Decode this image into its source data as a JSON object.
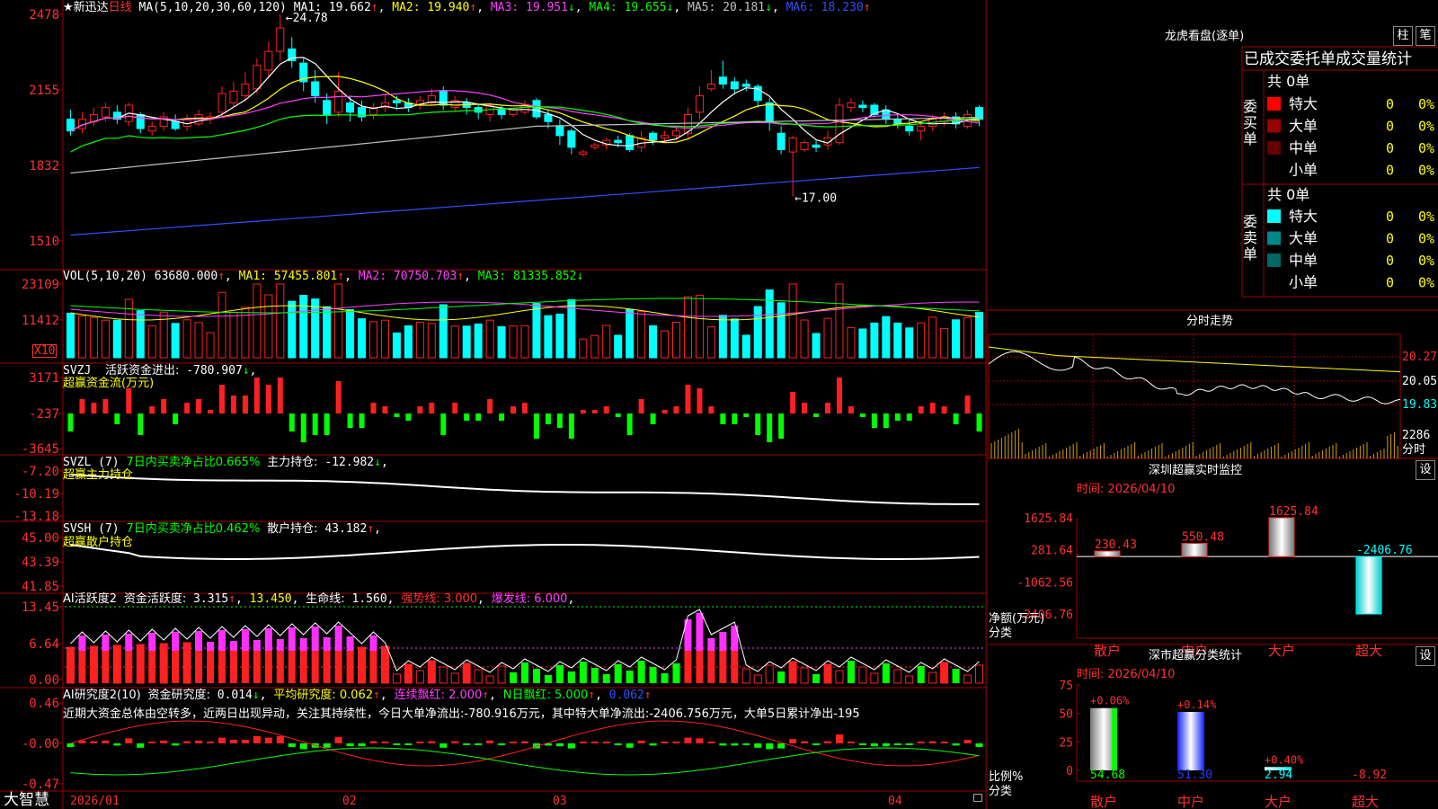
{
  "app": {
    "brand": "大智慧",
    "lock": "🔒"
  },
  "kline": {
    "title": "★新迅达",
    "period": "日线",
    "ma_params": "MA(5,10,20,30,60,120)",
    "ma": [
      {
        "label": "MA1:",
        "value": "19.662",
        "arrow": "↑",
        "color": "#ffffff"
      },
      {
        "label": "MA2:",
        "value": "19.940",
        "arrow": "↑",
        "color": "#ffff00"
      },
      {
        "label": "MA3:",
        "value": "19.951",
        "arrow": "↓",
        "color": "#ff40ff"
      },
      {
        "label": "MA4:",
        "value": "19.655",
        "arrow": "↓",
        "color": "#00ff00"
      },
      {
        "label": "MA5:",
        "value": "20.181",
        "arrow": "↓",
        "color": "#c0c0c0"
      },
      {
        "label": "MA6:",
        "value": "18.230",
        "arrow": "↑",
        "color": "#3050ff"
      }
    ],
    "y_ticks": [
      "2478",
      "2155",
      "1832",
      "1510"
    ],
    "high_mark": "24.78",
    "low_mark": "17.00"
  },
  "volume": {
    "title": "VOL(5,10,20)",
    "value": "63680.000",
    "value_arrow": "↑",
    "ma": [
      {
        "label": "MA1:",
        "value": "57455.801",
        "arrow": "↑",
        "color": "#ffff00"
      },
      {
        "label": "MA2:",
        "value": "70750.703",
        "arrow": "↑",
        "color": "#ff40ff"
      },
      {
        "label": "MA3:",
        "value": "81335.852",
        "arrow": "↓",
        "color": "#00ff00"
      }
    ],
    "y_ticks": [
      "23109",
      "11412"
    ],
    "unit": "X10"
  },
  "svzj": {
    "title": "SVZJ",
    "label": "活跃资金进出:",
    "value": "-780.907",
    "arrow": "↓",
    "subtitle": "超赢资金流(万元)",
    "y_ticks": [
      "3171",
      "-237",
      "-3645"
    ]
  },
  "svzl": {
    "title": "SVZL (7)",
    "ratio_label": "7日内买卖净占比0.665%",
    "hold_label": "主力持仓:",
    "hold_value": "-12.982",
    "arrow": "↓",
    "subtitle": "超赢主力持仓",
    "y_ticks": [
      "-7.20",
      "-10.19",
      "-13.18"
    ]
  },
  "svsh": {
    "title": "SVSH (7)",
    "ratio_label": "7日内买卖净占比0.462%",
    "hold_label": "散户持仓:",
    "hold_value": "43.182",
    "arrow": "↑",
    "subtitle": "超赢散户持仓",
    "y_ticks": [
      "45.00",
      "43.39",
      "41.85"
    ]
  },
  "ai_active": {
    "title": "AI活跃度2",
    "label": "资金活跃度:",
    "value": "3.315",
    "arrow": "↑",
    "v2": "13.450",
    "life_label": "生命线:",
    "life_value": "1.560",
    "strong": "强势线: 3.000",
    "burst": "爆发线: 6.000",
    "y_ticks": [
      "13.45",
      "6.64",
      "0.00"
    ]
  },
  "ai_research": {
    "title": "AI研究度2(10)",
    "label": "资金研究度:",
    "value": "0.014",
    "arrow": "↓",
    "avg": "平均研究度: 0.062",
    "cont": "连续飘红: 2.000",
    "nday": "N日飘红: 5.000",
    "last": "0.062",
    "comment": "近期大资金总体由空转多，近两日出现异动，关注其持续性，今日大单净流出:-780.916万元，其中特大单净流出:-2406.756万元，大单5日累计净出-195",
    "y_ticks": [
      "0.46",
      "-0.00",
      "-0.47"
    ]
  },
  "x_axis": [
    "2026/01",
    "02",
    "03",
    "04"
  ],
  "dragon": {
    "title": "龙虎看盘(逐单)",
    "btn1": "柱",
    "btn2": "笔",
    "header": "已成交委托单成交量统计",
    "buy_side": "委买单",
    "sell_side": "委卖单",
    "buy_total": "共 0单",
    "sell_total": "共 0单",
    "buy_rows": [
      {
        "name": "特大",
        "count": "0",
        "pct": "0%",
        "color": "#ff0000"
      },
      {
        "name": "大单",
        "count": "0",
        "pct": "0%",
        "color": "#990000"
      },
      {
        "name": "中单",
        "count": "0",
        "pct": "0%",
        "color": "#660000"
      },
      {
        "name": "小单",
        "count": "0",
        "pct": "0%",
        "color": "#000000"
      }
    ],
    "sell_rows": [
      {
        "name": "特大",
        "count": "0",
        "pct": "0%",
        "color": "#00ffff"
      },
      {
        "name": "大单",
        "count": "0",
        "pct": "0%",
        "color": "#008888"
      },
      {
        "name": "中单",
        "count": "0",
        "pct": "0%",
        "color": "#006666"
      },
      {
        "name": "小单",
        "count": "0",
        "pct": "0%",
        "color": "#000000"
      }
    ]
  },
  "intraday": {
    "title": "分时走势",
    "y_ticks": [
      "20.27",
      "20.05",
      "19.83"
    ],
    "vol_tick": "2286",
    "vol_unit": "分时"
  },
  "sz_monitor": {
    "title": "深圳超赢实时监控",
    "btn": "设",
    "time": "时间: 2026/04/10",
    "y_label1": "净额(万元)",
    "y_label2": "分类",
    "y_ticks": [
      "1625.84",
      "281.64",
      "-1062.56",
      "-2406.76"
    ],
    "bars": [
      {
        "name": "散户",
        "value": 230.43,
        "label": "230.43"
      },
      {
        "name": "中户",
        "value": 550.48,
        "label": "550.48"
      },
      {
        "name": "大户",
        "value": 1625.84,
        "label": "1625.84"
      },
      {
        "name": "超大",
        "value": -2406.76,
        "label": "-2406.76"
      }
    ]
  },
  "sz_class": {
    "title": "深市超赢分类统计",
    "btn": "设",
    "time": "时间: 2026/04/10",
    "y_label1": "比例%",
    "y_label2": "分类",
    "y_ticks": [
      "75",
      "50",
      "25",
      "0"
    ],
    "bars": [
      {
        "name": "散户",
        "pct": 54.68,
        "label": "54.68",
        "change": "+0.06%",
        "color": "#ffffff",
        "name_color": "#ff3030"
      },
      {
        "name": "中户",
        "pct": 51.3,
        "label": "51.30",
        "change": "+0.14%",
        "color": "#2040ff",
        "name_color": "#ff3030"
      },
      {
        "name": "大户",
        "pct": 2.94,
        "label": "2.94",
        "change": "+0.40%",
        "color": "#00ffff",
        "name_color": "#ff3030"
      },
      {
        "name": "超大",
        "pct": -8.92,
        "label": "-8.92",
        "change": "",
        "color": "#ff3030",
        "name_color": "#ff3030"
      }
    ]
  },
  "chart_data": {
    "type": "candlestick",
    "title": "★新迅达 日线",
    "ylim": [
      15.1,
      24.78
    ],
    "candles": [
      [
        20.3,
        19.8,
        20.7,
        19.6
      ],
      [
        19.9,
        20.3,
        20.6,
        19.7
      ],
      [
        20.2,
        20.5,
        20.8,
        20.0
      ],
      [
        20.4,
        20.8,
        21.0,
        20.2
      ],
      [
        20.6,
        20.3,
        20.9,
        20.1
      ],
      [
        20.2,
        20.9,
        21.0,
        20.0
      ],
      [
        20.5,
        19.9,
        20.6,
        19.7
      ],
      [
        19.8,
        20.0,
        20.2,
        19.6
      ],
      [
        20.0,
        20.4,
        20.6,
        19.8
      ],
      [
        20.2,
        19.9,
        20.5,
        19.8
      ],
      [
        20.0,
        20.3,
        20.5,
        19.8
      ],
      [
        20.1,
        20.5,
        20.7,
        20.0
      ],
      [
        20.3,
        20.4,
        20.6,
        20.1
      ],
      [
        20.6,
        21.4,
        21.7,
        20.4
      ],
      [
        21.0,
        21.5,
        21.9,
        20.8
      ],
      [
        21.3,
        21.8,
        22.3,
        21.1
      ],
      [
        21.6,
        22.6,
        22.9,
        21.4
      ],
      [
        22.4,
        23.2,
        23.6,
        22.1
      ],
      [
        23.2,
        24.2,
        24.78,
        22.8
      ],
      [
        23.3,
        22.8,
        23.8,
        22.5
      ],
      [
        22.7,
        21.9,
        22.9,
        21.5
      ],
      [
        21.9,
        21.3,
        22.4,
        21.0
      ],
      [
        21.1,
        20.5,
        21.4,
        20.1
      ],
      [
        20.6,
        21.5,
        22.3,
        20.4
      ],
      [
        21.0,
        20.6,
        21.3,
        20.2
      ],
      [
        20.8,
        20.4,
        21.1,
        20.2
      ],
      [
        20.5,
        20.8,
        21.0,
        20.3
      ],
      [
        20.8,
        21.0,
        21.4,
        20.6
      ],
      [
        21.1,
        21.0,
        21.3,
        20.7
      ],
      [
        21.0,
        20.8,
        21.2,
        20.6
      ],
      [
        20.9,
        21.1,
        21.3,
        20.7
      ],
      [
        21.0,
        21.3,
        21.6,
        20.9
      ],
      [
        21.5,
        20.9,
        21.7,
        20.7
      ],
      [
        20.8,
        21.1,
        21.3,
        20.6
      ],
      [
        21.0,
        20.8,
        21.2,
        20.5
      ],
      [
        20.8,
        20.6,
        20.9,
        20.3
      ],
      [
        20.5,
        20.9,
        21.0,
        20.2
      ],
      [
        20.7,
        20.5,
        20.9,
        20.3
      ],
      [
        20.5,
        20.7,
        20.8,
        20.4
      ],
      [
        20.6,
        20.9,
        21.1,
        20.5
      ],
      [
        21.1,
        20.4,
        21.2,
        20.3
      ],
      [
        20.5,
        20.2,
        20.7,
        19.9
      ],
      [
        20.0,
        19.6,
        20.3,
        19.2
      ],
      [
        19.8,
        19.1,
        19.9,
        18.8
      ],
      [
        18.8,
        18.9,
        19.0,
        18.7
      ],
      [
        19.1,
        19.2,
        19.3,
        19.0
      ],
      [
        19.2,
        19.4,
        19.5,
        19.0
      ],
      [
        19.4,
        19.3,
        19.6,
        19.1
      ],
      [
        19.6,
        19.0,
        19.7,
        18.9
      ],
      [
        19.1,
        19.5,
        19.8,
        18.9
      ],
      [
        19.7,
        19.4,
        19.8,
        19.2
      ],
      [
        19.5,
        19.6,
        19.8,
        19.3
      ],
      [
        19.6,
        19.8,
        20.0,
        19.4
      ],
      [
        19.7,
        20.5,
        20.8,
        19.5
      ],
      [
        20.6,
        21.3,
        21.7,
        20.3
      ],
      [
        21.6,
        21.8,
        22.4,
        21.5
      ],
      [
        22.1,
        21.8,
        22.8,
        21.6
      ],
      [
        21.9,
        21.6,
        22.1,
        21.4
      ],
      [
        21.8,
        21.7,
        22.0,
        21.5
      ],
      [
        21.7,
        21.1,
        21.8,
        20.8
      ],
      [
        21.0,
        20.2,
        21.2,
        19.8
      ],
      [
        19.7,
        19.0,
        20.0,
        18.8
      ],
      [
        18.9,
        19.5,
        19.6,
        17.0
      ],
      [
        19.0,
        19.3,
        19.4,
        18.9
      ],
      [
        19.2,
        19.1,
        19.4,
        18.9
      ],
      [
        19.2,
        19.5,
        19.8,
        19.0
      ],
      [
        19.3,
        20.9,
        21.2,
        19.2
      ],
      [
        20.8,
        21.0,
        21.2,
        20.6
      ],
      [
        20.9,
        20.8,
        21.1,
        20.6
      ],
      [
        20.9,
        20.5,
        21.0,
        20.4
      ],
      [
        20.7,
        20.3,
        20.9,
        20.1
      ],
      [
        20.3,
        20.1,
        20.5,
        19.9
      ],
      [
        20.0,
        19.8,
        20.3,
        19.6
      ],
      [
        19.8,
        20.0,
        20.2,
        19.4
      ],
      [
        20.0,
        20.3,
        20.5,
        19.8
      ],
      [
        20.2,
        20.4,
        20.6,
        20.0
      ],
      [
        20.4,
        20.1,
        20.6,
        19.9
      ],
      [
        20.0,
        20.5,
        20.7,
        19.9
      ],
      [
        20.8,
        20.3,
        20.9,
        20.0
      ]
    ]
  }
}
